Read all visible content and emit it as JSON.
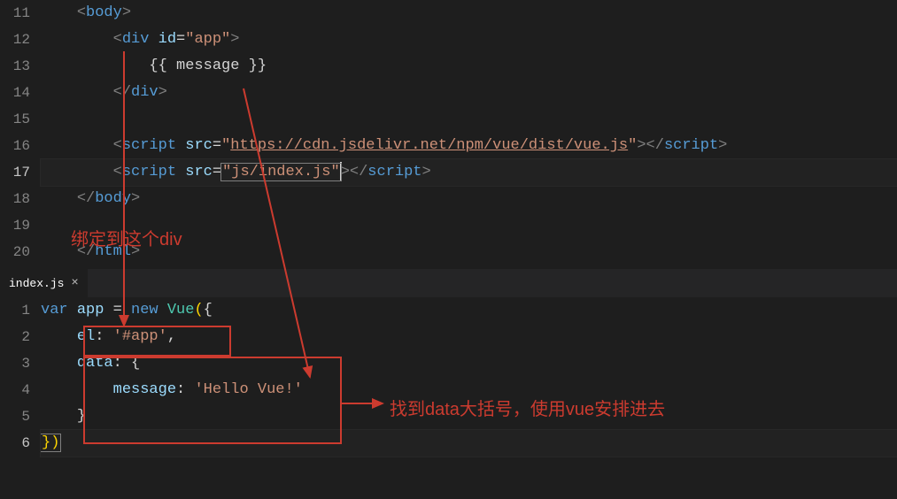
{
  "top_editor": {
    "lines": [
      {
        "n": "11",
        "tokens": [
          {
            "cls": "tok-brkt",
            "t": "<"
          },
          {
            "cls": "tok-tag",
            "t": "body"
          },
          {
            "cls": "tok-brkt",
            "t": ">"
          }
        ],
        "indent": 1
      },
      {
        "n": "12",
        "tokens": [
          {
            "cls": "tok-brkt",
            "t": "<"
          },
          {
            "cls": "tok-tag",
            "t": "div"
          },
          {
            "cls": "",
            "t": " "
          },
          {
            "cls": "tok-attr",
            "t": "id"
          },
          {
            "cls": "tok-pun",
            "t": "="
          },
          {
            "cls": "tok-str",
            "t": "\"app\""
          },
          {
            "cls": "tok-brkt",
            "t": ">"
          }
        ],
        "indent": 2
      },
      {
        "n": "13",
        "tokens": [
          {
            "cls": "tok-text",
            "t": "{{ message }}"
          }
        ],
        "indent": 3
      },
      {
        "n": "14",
        "tokens": [
          {
            "cls": "tok-brkt",
            "t": "</"
          },
          {
            "cls": "tok-tag",
            "t": "div"
          },
          {
            "cls": "tok-brkt",
            "t": ">"
          }
        ],
        "indent": 2
      },
      {
        "n": "15",
        "tokens": [],
        "indent": 0
      },
      {
        "n": "16",
        "tokens": [
          {
            "cls": "tok-brkt",
            "t": "<"
          },
          {
            "cls": "tok-tag",
            "t": "script"
          },
          {
            "cls": "",
            "t": " "
          },
          {
            "cls": "tok-attr",
            "t": "src"
          },
          {
            "cls": "tok-pun",
            "t": "="
          },
          {
            "cls": "tok-str",
            "t": "\""
          },
          {
            "cls": "tok-link",
            "t": "https://cdn.jsdelivr.net/npm/vue/dist/vue.js"
          },
          {
            "cls": "tok-str",
            "t": "\""
          },
          {
            "cls": "tok-brkt",
            "t": "></"
          },
          {
            "cls": "tok-tag",
            "t": "script"
          },
          {
            "cls": "tok-brkt",
            "t": ">"
          }
        ],
        "indent": 2
      },
      {
        "n": "17",
        "active": true,
        "tokens": [
          {
            "cls": "tok-brkt",
            "t": "<"
          },
          {
            "cls": "tok-tag",
            "t": "script"
          },
          {
            "cls": "",
            "t": " "
          },
          {
            "cls": "tok-attr",
            "t": "src"
          },
          {
            "cls": "tok-pun",
            "t": "="
          },
          {
            "cls": "tok-str sel-box",
            "t": "\"js/index.js\""
          },
          {
            "cls": "cursor",
            "t": ""
          },
          {
            "cls": "tok-brkt",
            "t": "></"
          },
          {
            "cls": "tok-tag",
            "t": "script"
          },
          {
            "cls": "tok-brkt",
            "t": ">"
          }
        ],
        "indent": 2
      },
      {
        "n": "18",
        "tokens": [
          {
            "cls": "tok-brkt",
            "t": "</"
          },
          {
            "cls": "tok-tag",
            "t": "body"
          },
          {
            "cls": "tok-brkt",
            "t": ">"
          }
        ],
        "indent": 1
      },
      {
        "n": "19",
        "tokens": [],
        "indent": 0
      },
      {
        "n": "20",
        "tokens": [
          {
            "cls": "tok-brkt",
            "t": "</"
          },
          {
            "cls": "tok-tag",
            "t": "html"
          },
          {
            "cls": "tok-brkt",
            "t": ">"
          }
        ],
        "indent": 1
      }
    ]
  },
  "tab": {
    "filename": "index.js",
    "close": "×"
  },
  "bottom_editor": {
    "lines": [
      {
        "n": "1",
        "tokens": [
          {
            "cls": "tok-kw",
            "t": "var"
          },
          {
            "cls": "",
            "t": " "
          },
          {
            "cls": "tok-var",
            "t": "app"
          },
          {
            "cls": "",
            "t": " "
          },
          {
            "cls": "tok-pun",
            "t": "="
          },
          {
            "cls": "",
            "t": " "
          },
          {
            "cls": "tok-kw",
            "t": "new"
          },
          {
            "cls": "",
            "t": " "
          },
          {
            "cls": "tok-cls",
            "t": "Vue"
          },
          {
            "cls": "tok-yel",
            "t": "("
          },
          {
            "cls": "tok-pun",
            "t": "{"
          }
        ],
        "indent": 0
      },
      {
        "n": "2",
        "tokens": [
          {
            "cls": "tok-var",
            "t": "el"
          },
          {
            "cls": "tok-pun",
            "t": ":"
          },
          {
            "cls": "",
            "t": " "
          },
          {
            "cls": "tok-str",
            "t": "'#app'"
          },
          {
            "cls": "tok-pun",
            "t": ","
          }
        ],
        "indent": 1
      },
      {
        "n": "3",
        "tokens": [
          {
            "cls": "tok-var",
            "t": "data"
          },
          {
            "cls": "tok-pun",
            "t": ":"
          },
          {
            "cls": "",
            "t": " "
          },
          {
            "cls": "tok-pun",
            "t": "{"
          }
        ],
        "indent": 1
      },
      {
        "n": "4",
        "tokens": [
          {
            "cls": "tok-var",
            "t": "message"
          },
          {
            "cls": "tok-pun",
            "t": ":"
          },
          {
            "cls": "",
            "t": " "
          },
          {
            "cls": "tok-str",
            "t": "'Hello Vue!'"
          }
        ],
        "indent": 2
      },
      {
        "n": "5",
        "tokens": [
          {
            "cls": "tok-pun",
            "t": "}"
          }
        ],
        "indent": 1
      },
      {
        "n": "6",
        "active": true,
        "tokens": [
          {
            "cls": "tok-yel sel-box",
            "t": "})"
          }
        ],
        "indent": 0
      }
    ]
  },
  "annotations": {
    "bind_text": "绑定到这个div",
    "data_text": "找到data大括号，使用vue安排进去"
  },
  "colors": {
    "accent_red": "#cc3b2f",
    "bg": "#1e1e1e"
  }
}
